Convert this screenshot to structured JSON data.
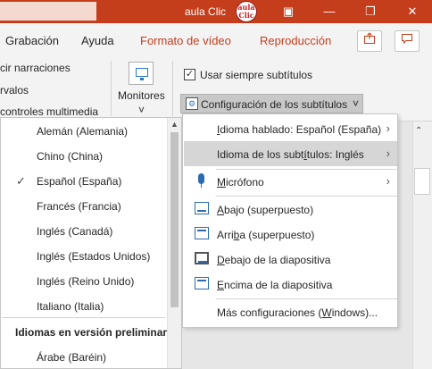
{
  "titlebar": {
    "app_title": "aula Clic",
    "logo_text_top": "aula",
    "logo_text_bottom": "Clic",
    "controls": [
      "—",
      "▣",
      "❐",
      "✕"
    ]
  },
  "ribbon_tabs": {
    "grabacion": "Grabación",
    "ayuda": "Ayuda",
    "formato_video": "Formato de vídeo",
    "reproduccion": "Reproducción",
    "share_icon": "share-icon",
    "comments_icon": "comment-icon"
  },
  "ribbon": {
    "narr": "cir narraciones",
    "ervalos": "rvalos",
    "controles": "controles multimedia",
    "monitores": "Monitores",
    "monitores_caret": "˅",
    "usar_subtitulos": "Usar siempre subtítulos",
    "usar_subtitulos_checked": true,
    "config_subtitulos": "Configuración de los subtítulos",
    "config_caret": "˅"
  },
  "languages": {
    "items": [
      {
        "label": "Alemán (Alemania)",
        "checked": false
      },
      {
        "label": "Chino (China)",
        "checked": false
      },
      {
        "label": "Español (España)",
        "checked": true
      },
      {
        "label": "Francés (Francia)",
        "checked": false
      },
      {
        "label": "Inglés (Canadá)",
        "checked": false
      },
      {
        "label": "Inglés (Estados Unidos)",
        "checked": false
      },
      {
        "label": "Inglés (Reino Unido)",
        "checked": false
      },
      {
        "label": "Italiano (Italia)",
        "checked": false
      }
    ],
    "preview_heading": "Idiomas en versión preliminar",
    "preview_items": [
      {
        "label": "Árabe (Baréin)"
      }
    ]
  },
  "menu": {
    "idioma_hablado_prefix": "I",
    "idioma_hablado_rest": "dioma hablado: Español (España)",
    "idioma_subtitulos_pre": "Idioma de los subt",
    "idioma_subtitulos_u": "í",
    "idioma_subtitulos_post": "tulos: Inglés",
    "microfono_u": "M",
    "microfono_rest": "icrófono",
    "abajo_u": "A",
    "abajo_rest": "bajo (superpuesto)",
    "arriba_pre": "Arri",
    "arriba_u": "b",
    "arriba_rest": "a (superpuesto)",
    "debajo_u": "D",
    "debajo_rest": "ebajo de la diapositiva",
    "encima_u": "E",
    "encima_rest": "ncima de la diapositiva",
    "mas_pre": "Más configuraciones (",
    "mas_u": "W",
    "mas_rest": "indows)..."
  }
}
